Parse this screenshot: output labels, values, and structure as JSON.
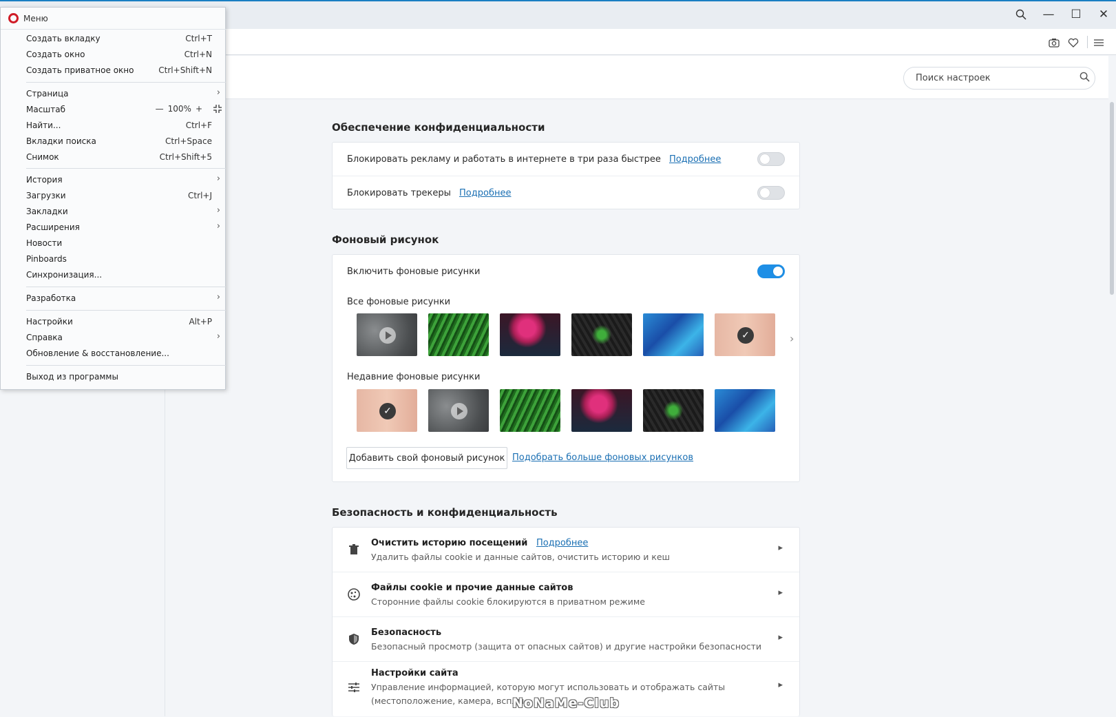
{
  "window": {
    "search_icon": "search-icon",
    "minimize": "—",
    "maximize": "☐",
    "close": "✕"
  },
  "toolbar": {
    "snapshot_icon": "camera-icon",
    "favorites_icon": "heart-icon",
    "easy_setup_icon": "sliders-icon"
  },
  "settings_search": {
    "placeholder": "Поиск настроек"
  },
  "privacy": {
    "title": "Обеспечение конфиденциальности",
    "rows": [
      {
        "text": "Блокировать рекламу и работать в интернете в три раза быстрее",
        "link": "Подробнее",
        "enabled": false
      },
      {
        "text": "Блокировать трекеры",
        "link": "Подробнее",
        "enabled": false
      }
    ]
  },
  "wallpapers": {
    "title": "Фоновый рисунок",
    "enable_label": "Включить фоновые рисунки",
    "enabled": true,
    "all_label": "Все фоновые рисунки",
    "recent_label": "Недавние фоновые рисунки",
    "add_button": "Добавить свой фоновый рисунок",
    "more_link": "Подобрать больше фоновых рисунков"
  },
  "security": {
    "title": "Безопасность и конфиденциальность",
    "items": [
      {
        "icon": "trash-icon",
        "title": "Очистить историю посещений",
        "link": "Подробнее",
        "desc": "Удалить файлы cookie и данные сайтов, очистить историю и кеш"
      },
      {
        "icon": "cookie-icon",
        "title": "Файлы cookie и прочие данные сайтов",
        "link": "",
        "desc": "Сторонние файлы cookie блокируются в приватном режиме"
      },
      {
        "icon": "shield-icon",
        "title": "Безопасность",
        "link": "",
        "desc": "Безопасный просмотр (защита от опасных сайтов) и другие настройки безопасности"
      },
      {
        "icon": "tune-icon",
        "title": "Настройки сайта",
        "link": "",
        "desc": "Управление информацией, которую могут использовать и отображать сайты",
        "desc2": "(местоположение, камера, всплы"
      }
    ]
  },
  "menu": {
    "title": "Меню",
    "items": [
      {
        "label": "Создать вкладку",
        "shortcut": "Ctrl+T"
      },
      {
        "label": "Создать окно",
        "shortcut": "Ctrl+N"
      },
      {
        "label": "Создать приватное окно",
        "shortcut": "Ctrl+Shift+N"
      },
      {
        "label": "Страница",
        "shortcut": ""
      },
      {
        "label": "Масштаб",
        "shortcut": ""
      },
      {
        "label": "Найти...",
        "shortcut": "Ctrl+F"
      },
      {
        "label": "Вкладки поиска",
        "shortcut": "Ctrl+Space"
      },
      {
        "label": "Снимок",
        "shortcut": "Ctrl+Shift+5"
      },
      {
        "label": "История",
        "shortcut": ""
      },
      {
        "label": "Загрузки",
        "shortcut": "Ctrl+J"
      },
      {
        "label": "Закладки",
        "shortcut": ""
      },
      {
        "label": "Расширения",
        "shortcut": ""
      },
      {
        "label": "Новости",
        "shortcut": ""
      },
      {
        "label": "Pinboards",
        "shortcut": ""
      },
      {
        "label": "Синхронизация...",
        "shortcut": ""
      },
      {
        "label": "Разработка",
        "shortcut": ""
      },
      {
        "label": "Настройки",
        "shortcut": "Alt+P"
      },
      {
        "label": "Справка",
        "shortcut": ""
      },
      {
        "label": "Обновление & восстановление...",
        "shortcut": ""
      },
      {
        "label": "Выход из программы",
        "shortcut": ""
      }
    ],
    "zoom": {
      "minus": "—",
      "value": "100%",
      "plus": "+",
      "fullscreen_icon": "fullscreen-icon"
    }
  },
  "watermark": "NoNaMe-Club"
}
